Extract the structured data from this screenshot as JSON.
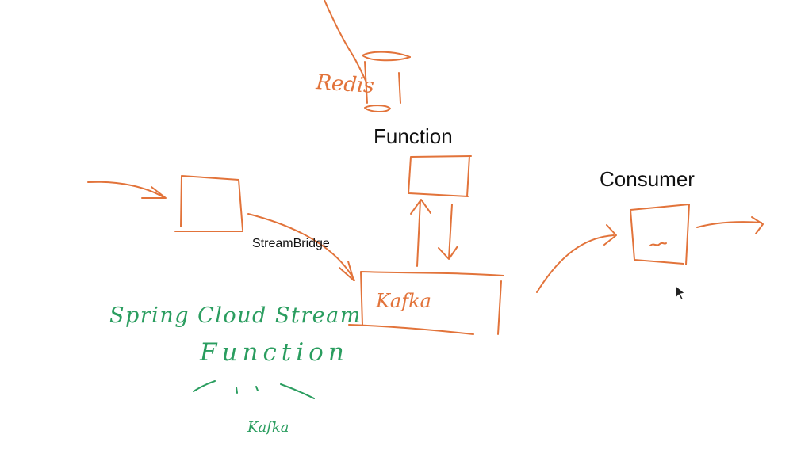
{
  "diagram": {
    "labels": {
      "function": "Function",
      "consumer": "Consumer",
      "stream_bridge": "StreamBridge"
    },
    "handwriting": {
      "redis": "Redis",
      "kafka_box": "Kafka",
      "spring_cloud_stream": "Spring Cloud Stream",
      "function_note": "Function",
      "kafka_note": "Kafka",
      "consumer_box_mark": "~"
    },
    "colors": {
      "orange_ink": "#e2733a",
      "green_ink": "#2a9d5f",
      "typed_text": "#111111",
      "background": "#ffffff"
    }
  }
}
